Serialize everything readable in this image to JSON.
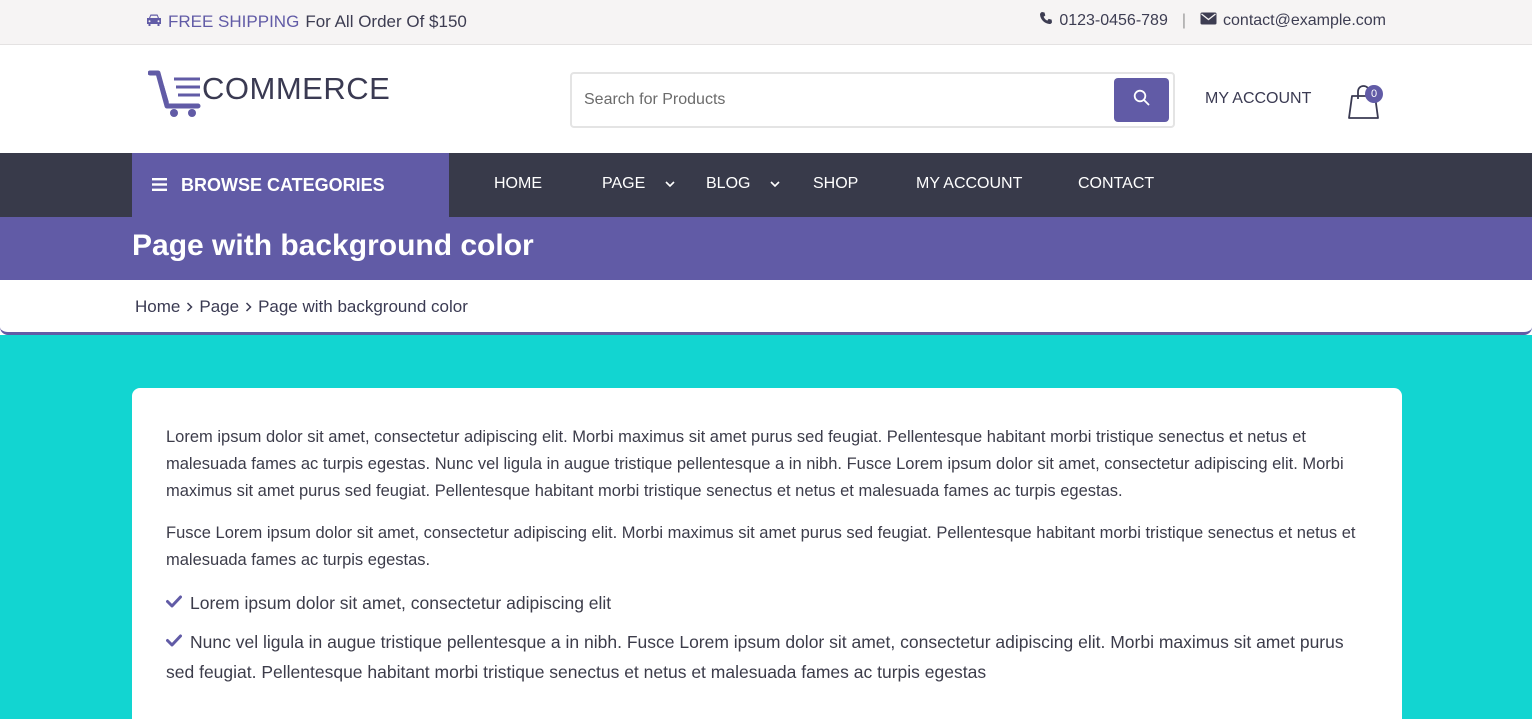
{
  "topbar": {
    "shipping_highlight": "FREE SHIPPING",
    "shipping_rest": "For All Order Of $150",
    "phone": "0123-0456-789",
    "separator": "|",
    "email": "contact@example.com"
  },
  "header": {
    "logo_text": "COMMERCE",
    "search_placeholder": "Search for Products",
    "my_account": "MY ACCOUNT",
    "cart_count": "0"
  },
  "nav": {
    "browse_label": "BROWSE CATEGORIES",
    "items": [
      {
        "label": "HOME"
      },
      {
        "label": "PAGE"
      },
      {
        "label": "BLOG"
      },
      {
        "label": "SHOP"
      },
      {
        "label": "MY ACCOUNT"
      },
      {
        "label": "CONTACT"
      }
    ]
  },
  "page": {
    "title": "Page with background color",
    "breadcrumb": [
      "Home",
      "Page",
      "Page with background color"
    ]
  },
  "content": {
    "paragraphs": [
      "Lorem ipsum dolor sit amet, consectetur adipiscing elit. Morbi maximus sit amet purus sed feugiat. Pellentesque habitant morbi tristique senectus et netus et malesuada fames ac turpis egestas. Nunc vel ligula in augue tristique pellentesque a in nibh. Fusce Lorem ipsum dolor sit amet, consectetur adipiscing elit. Morbi maximus sit amet purus sed feugiat. Pellentesque habitant morbi tristique senectus et netus et malesuada fames ac turpis egestas.",
      "Fusce Lorem ipsum dolor sit amet, consectetur adipiscing elit. Morbi maximus sit amet purus sed feugiat. Pellentesque habitant morbi tristique senectus et netus et malesuada fames ac turpis egestas."
    ],
    "list": [
      "Lorem ipsum dolor sit amet, consectetur adipiscing elit",
      "Nunc vel ligula in augue tristique pellentesque a in nibh. Fusce Lorem ipsum dolor sit amet, consectetur adipiscing elit. Morbi maximus sit amet purus sed feugiat. Pellentesque habitant morbi tristique senectus et netus et malesuada fames ac turpis egestas"
    ]
  },
  "colors": {
    "accent": "#615ba6",
    "nav_bg": "#383a4a",
    "page_bg": "#12d5d1"
  }
}
